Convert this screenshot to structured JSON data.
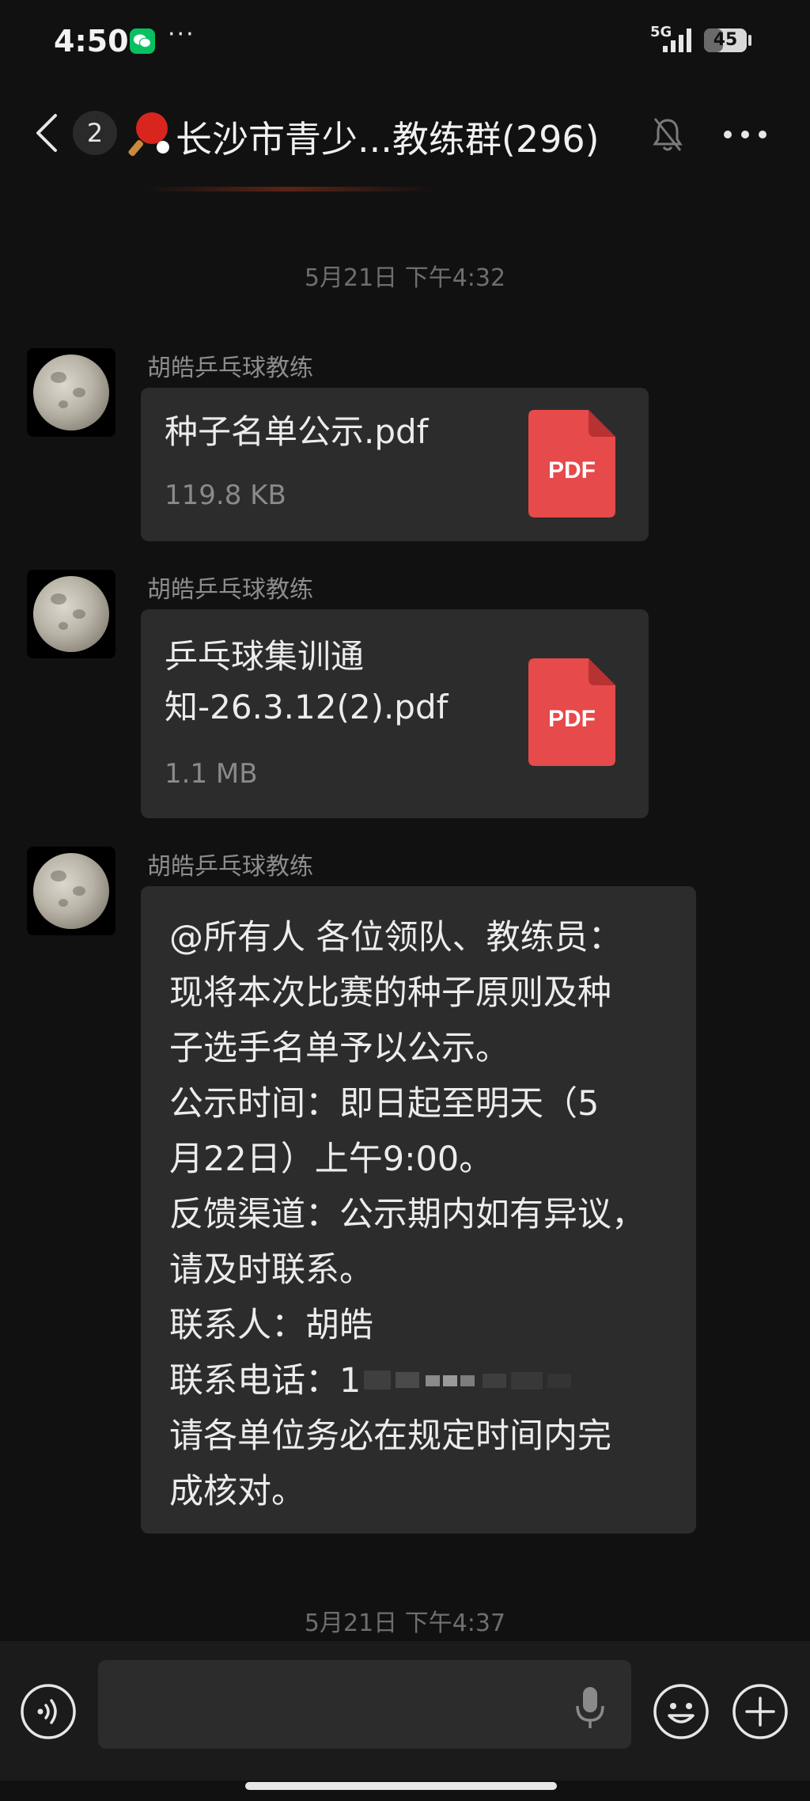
{
  "status_bar": {
    "time": "4:50",
    "dots": "···",
    "network": "5G",
    "battery_level": "45",
    "battery_fraction": 0.45
  },
  "nav": {
    "unread_count": "2",
    "title": "长沙市青少...教练群(296)"
  },
  "timestamps": [
    "5月21日 下午4:32",
    "5月21日 下午4:37"
  ],
  "messages": [
    {
      "sender": "胡皓乒乓球教练",
      "type": "file",
      "file_name_lines": [
        "种子名单公示.pdf"
      ],
      "file_size": "119.8 KB",
      "file_badge": "PDF"
    },
    {
      "sender": "胡皓乒乓球教练",
      "type": "file",
      "file_name_lines": [
        "乒乓球集训通",
        "知-26.3.12(2).pdf"
      ],
      "file_size": "1.1 MB",
      "file_badge": "PDF"
    },
    {
      "sender": "胡皓乒乓球教练",
      "type": "text",
      "lines": [
        "@所有人  各位领队、教练员：",
        "现将本次比赛的种子原则及种",
        "子选手名单予以公示。",
        "公示时间：即日起至明天（5",
        "月22日）上午9:00。",
        "反馈渠道：公示期内如有异议，",
        "请及时联系。",
        "联系人：胡皓",
        "联系电话：1",
        "请各单位务必在规定时间内完",
        "成核对。"
      ]
    }
  ],
  "colors": {
    "background": "#111111",
    "bubble": "#2c2c2c",
    "pdf_red": "#e64a4a",
    "wechat_green": "#07c160"
  },
  "icons": [
    "back-arrow-icon",
    "ping-pong-paddle-icon",
    "mute-bell-icon",
    "more-dots-icon",
    "voice-icon",
    "microphone-icon",
    "emoji-icon",
    "plus-icon",
    "pdf-file-icon"
  ]
}
